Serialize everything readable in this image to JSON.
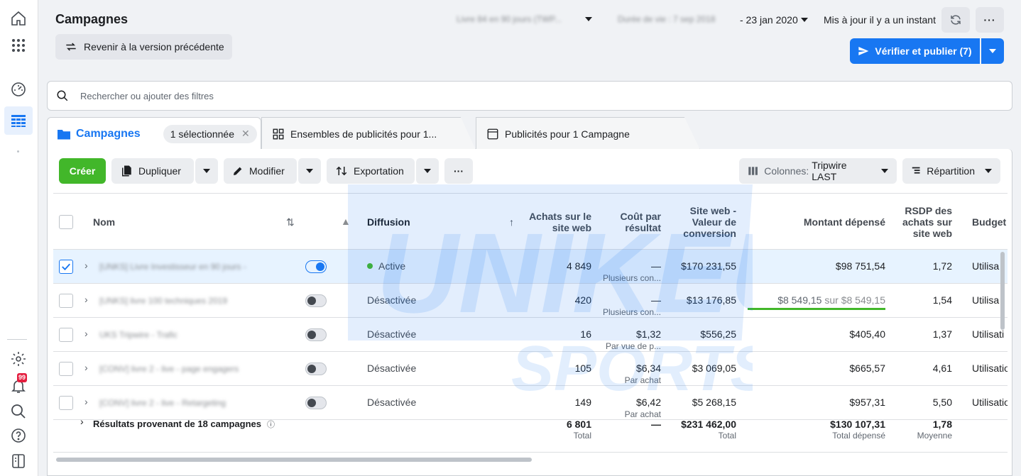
{
  "header": {
    "title": "Campagnes",
    "revert_label": "Revenir à la version précédente",
    "blurred_attribution": "Livre 84 en 90 jours (TWP...",
    "blurred_date_prefix": "Durée de vie : 7 sep 2018",
    "date_end": "- 23 jan 2020",
    "updated": "Mis à jour il y a un instant",
    "publish_label": "Vérifier et publier (7)"
  },
  "search": {
    "placeholder": "Rechercher ou ajouter des filtres"
  },
  "tabs": [
    {
      "label": "Campagnes",
      "chip": "1 sélectionnée"
    },
    {
      "label": "Ensembles de publicités pour 1..."
    },
    {
      "label": "Publicités pour 1 Campagne"
    }
  ],
  "toolbar": {
    "create": "Créer",
    "duplicate": "Dupliquer",
    "edit": "Modifier",
    "export": "Exportation",
    "columns_prefix": "Colonnes:",
    "columns_value": "Tripwire LAST",
    "breakdown": "Répartition"
  },
  "table": {
    "headers": {
      "name": "Nom",
      "delivery": "Diffusion",
      "purchases": [
        "Achats sur le",
        "site web"
      ],
      "cost": [
        "Coût par",
        "résultat"
      ],
      "value": [
        "Site web -",
        "Valeur de",
        "conversion"
      ],
      "spent": "Montant dépensé",
      "roas": [
        "RSDP des",
        "achats sur",
        "site web"
      ],
      "budget": "Budget"
    },
    "rows": [
      {
        "name": "[UNKS] Livre Investisseur en 90 jours -",
        "on": true,
        "status": "Active",
        "purchases": "4 849",
        "cost": "—",
        "cost_sub": "Plusieurs con...",
        "value": "$170 231,55",
        "spent": "$98 751,54",
        "spent_of": "",
        "roas": "1,72",
        "budget": "Utilisa"
      },
      {
        "name": "[UNKS] livre 100 techniques 2019",
        "on": false,
        "status": "Désactivée",
        "purchases": "420",
        "cost": "—",
        "cost_sub": "Plusieurs con...",
        "value": "$13 176,85",
        "spent": "$8 549,15",
        "spent_of": "sur $8 549,15",
        "roas": "1,54",
        "budget": "Utilisa"
      },
      {
        "name": "UKS Tripwire - Trafic",
        "on": false,
        "status": "Désactivée",
        "purchases": "16",
        "cost": "$1,32",
        "cost_sub": "Par vue de p...",
        "value": "$556,25",
        "spent": "$405,40",
        "spent_of": "",
        "roas": "1,37",
        "budget": "Utilisati"
      },
      {
        "name": "[CONV] livre 2 - live - page engagers",
        "on": false,
        "status": "Désactivée",
        "purchases": "105",
        "cost": "$6,34",
        "cost_sub": "Par achat",
        "value": "$3 069,05",
        "spent": "$665,57",
        "spent_of": "",
        "roas": "4,61",
        "budget": "Utilisatio"
      },
      {
        "name": "[CONV] livre 2 - live - Retargeting",
        "on": false,
        "status": "Désactivée",
        "purchases": "149",
        "cost": "$6,42",
        "cost_sub": "Par achat",
        "value": "$5 268,15",
        "spent": "$957,31",
        "spent_of": "",
        "roas": "5,50",
        "budget": "Utilisatio"
      }
    ],
    "footer": {
      "label": "Résultats provenant de 18 campagnes",
      "purchases": "6 801",
      "purchases_sub": "Total",
      "cost": "—",
      "value": "$231 462,00",
      "value_sub": "Total",
      "spent": "$130 107,31",
      "spent_sub": "Total dépensé",
      "roas": "1,78",
      "roas_sub": "Moyenne"
    }
  },
  "watermark": {
    "line1": "UNIKEU",
    "line2": "SPORTS"
  },
  "sidebar": {
    "badge": "99"
  },
  "colors": {
    "accent": "#1877f2",
    "create": "#42b72a",
    "progress": "#42b72a"
  }
}
